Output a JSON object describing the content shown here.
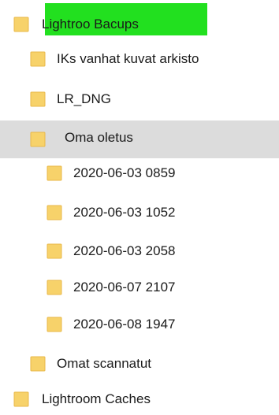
{
  "colors": {
    "folder_fill": "#f7d26a",
    "folder_tab": "#e8b84a",
    "highlight": "#22e01f",
    "selected_row": "#dcdcdc"
  },
  "tree": {
    "root": {
      "label": "Lightroo Bacups",
      "icon": "folder-icon"
    },
    "child_ik": {
      "label": "IKs vanhat kuvat arkisto",
      "icon": "folder-icon"
    },
    "child_lr": {
      "label": "LR_DNG",
      "icon": "folder-icon"
    },
    "child_oma": {
      "label": "Oma oletus",
      "icon": "folder-icon"
    },
    "grand_1": {
      "label": "2020-06-03 0859",
      "icon": "folder-icon"
    },
    "grand_2": {
      "label": "2020-06-03 1052",
      "icon": "folder-icon"
    },
    "grand_3": {
      "label": "2020-06-03 2058",
      "icon": "folder-icon"
    },
    "grand_4": {
      "label": "2020-06-07 2107",
      "icon": "folder-icon"
    },
    "grand_5": {
      "label": "2020-06-08 1947",
      "icon": "folder-icon"
    },
    "child_omat": {
      "label": "Omat scannatut",
      "icon": "folder-icon"
    },
    "root_caches": {
      "label": "Lightroom Caches",
      "icon": "folder-icon"
    }
  }
}
